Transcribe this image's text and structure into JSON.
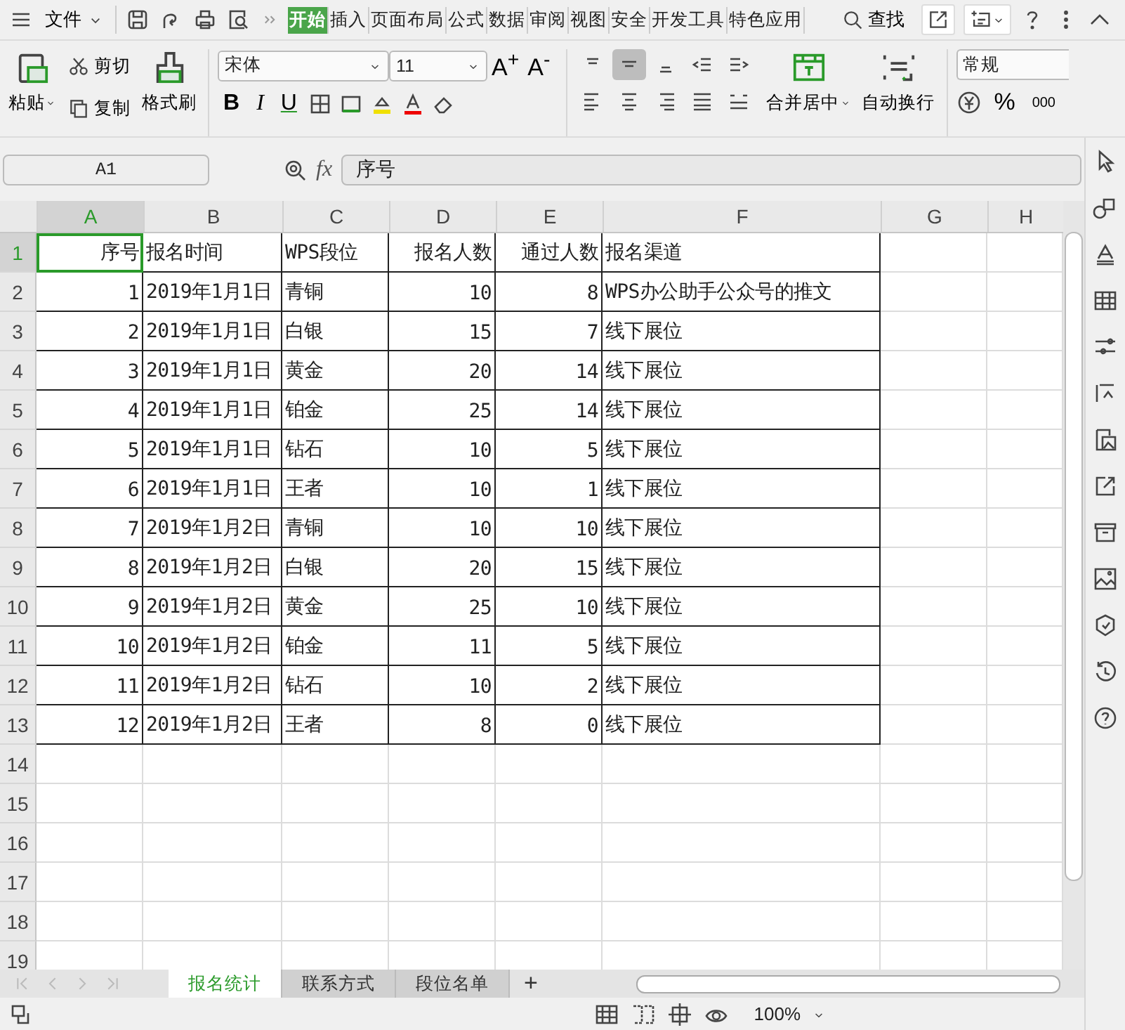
{
  "menu_bar": {
    "file_menu": "文件",
    "ribbon_tabs": [
      {
        "label": "开始",
        "selected": true
      },
      {
        "label": "插入",
        "selected": false
      },
      {
        "label": "页面布局",
        "selected": false
      },
      {
        "label": "公式",
        "selected": false
      },
      {
        "label": "数据",
        "selected": false
      },
      {
        "label": "审阅",
        "selected": false
      },
      {
        "label": "视图",
        "selected": false
      },
      {
        "label": "安全",
        "selected": false
      },
      {
        "label": "开发工具",
        "selected": false
      },
      {
        "label": "特色应用",
        "selected": false
      }
    ],
    "find": "查找"
  },
  "ribbon": {
    "paste": "粘贴",
    "cut": "剪切",
    "copy": "复制",
    "format_painter": "格式刷",
    "font_name": "宋体",
    "font_size": "11",
    "font_size_buttons": [
      "A$^{+}$",
      "A$^{-}$"
    ],
    "style_buttons": [
      "B",
      "I",
      "U"
    ],
    "merge": "合并居中",
    "wrap": "自动换行",
    "number_format": "常规",
    "percent": "%",
    "thousands": "000"
  },
  "formula_bar": {
    "cell_ref": "A1",
    "fx": "fx",
    "value": "序号"
  },
  "columns": [
    {
      "label": "A",
      "selected": true,
      "numeric": true
    },
    {
      "label": "B",
      "selected": false,
      "numeric": false
    },
    {
      "label": "C",
      "selected": false,
      "numeric": false
    },
    {
      "label": "D",
      "selected": false,
      "numeric": true
    },
    {
      "label": "E",
      "selected": false,
      "numeric": true
    },
    {
      "label": "F",
      "selected": false,
      "numeric": false
    },
    {
      "label": "G",
      "selected": false
    },
    {
      "label": "H",
      "selected": false
    }
  ],
  "rows": [
    {
      "number": "1",
      "selected": true,
      "cells": [
        "序号",
        "报名时间",
        "WPS段位",
        "报名人数",
        "通过人数",
        "报名渠道"
      ]
    },
    {
      "number": "2",
      "selected": false,
      "cells": [
        "1",
        "2019年1月1日",
        "青铜",
        "10",
        "8",
        "WPS办公助手公众号的推文"
      ]
    },
    {
      "number": "3",
      "selected": false,
      "cells": [
        "2",
        "2019年1月1日",
        "白银",
        "15",
        "7",
        "线下展位"
      ]
    },
    {
      "number": "4",
      "selected": false,
      "cells": [
        "3",
        "2019年1月1日",
        "黄金",
        "20",
        "14",
        "线下展位"
      ]
    },
    {
      "number": "5",
      "selected": false,
      "cells": [
        "4",
        "2019年1月1日",
        "铂金",
        "25",
        "14",
        "线下展位"
      ]
    },
    {
      "number": "6",
      "selected": false,
      "cells": [
        "5",
        "2019年1月1日",
        "钻石",
        "10",
        "5",
        "线下展位"
      ]
    },
    {
      "number": "7",
      "selected": false,
      "cells": [
        "6",
        "2019年1月1日",
        "王者",
        "10",
        "1",
        "线下展位"
      ]
    },
    {
      "number": "8",
      "selected": false,
      "cells": [
        "7",
        "2019年1月2日",
        "青铜",
        "10",
        "10",
        "线下展位"
      ]
    },
    {
      "number": "9",
      "selected": false,
      "cells": [
        "8",
        "2019年1月2日",
        "白银",
        "20",
        "15",
        "线下展位"
      ]
    },
    {
      "number": "10",
      "selected": false,
      "cells": [
        "9",
        "2019年1月2日",
        "黄金",
        "25",
        "10",
        "线下展位"
      ]
    },
    {
      "number": "11",
      "selected": false,
      "cells": [
        "10",
        "2019年1月2日",
        "铂金",
        "11",
        "5",
        "线下展位"
      ]
    },
    {
      "number": "12",
      "selected": false,
      "cells": [
        "11",
        "2019年1月2日",
        "钻石",
        "10",
        "2",
        "线下展位"
      ]
    },
    {
      "number": "13",
      "selected": false,
      "cells": [
        "12",
        "2019年1月2日",
        "王者",
        "8",
        "0",
        "线下展位"
      ]
    },
    {
      "number": "14",
      "selected": false,
      "cells": []
    },
    {
      "number": "15",
      "selected": false,
      "cells": []
    },
    {
      "number": "16",
      "selected": false,
      "cells": []
    },
    {
      "number": "17",
      "selected": false,
      "cells": []
    },
    {
      "number": "18",
      "selected": false,
      "cells": []
    },
    {
      "number": "19",
      "selected": false,
      "cells": []
    }
  ],
  "sheet_tabs": [
    {
      "label": "报名统计",
      "selected": true
    },
    {
      "label": "联系方式",
      "selected": false
    },
    {
      "label": "段位名单",
      "selected": false
    }
  ],
  "add_sheet": "+",
  "status_bar": {
    "zoom": "100%"
  }
}
